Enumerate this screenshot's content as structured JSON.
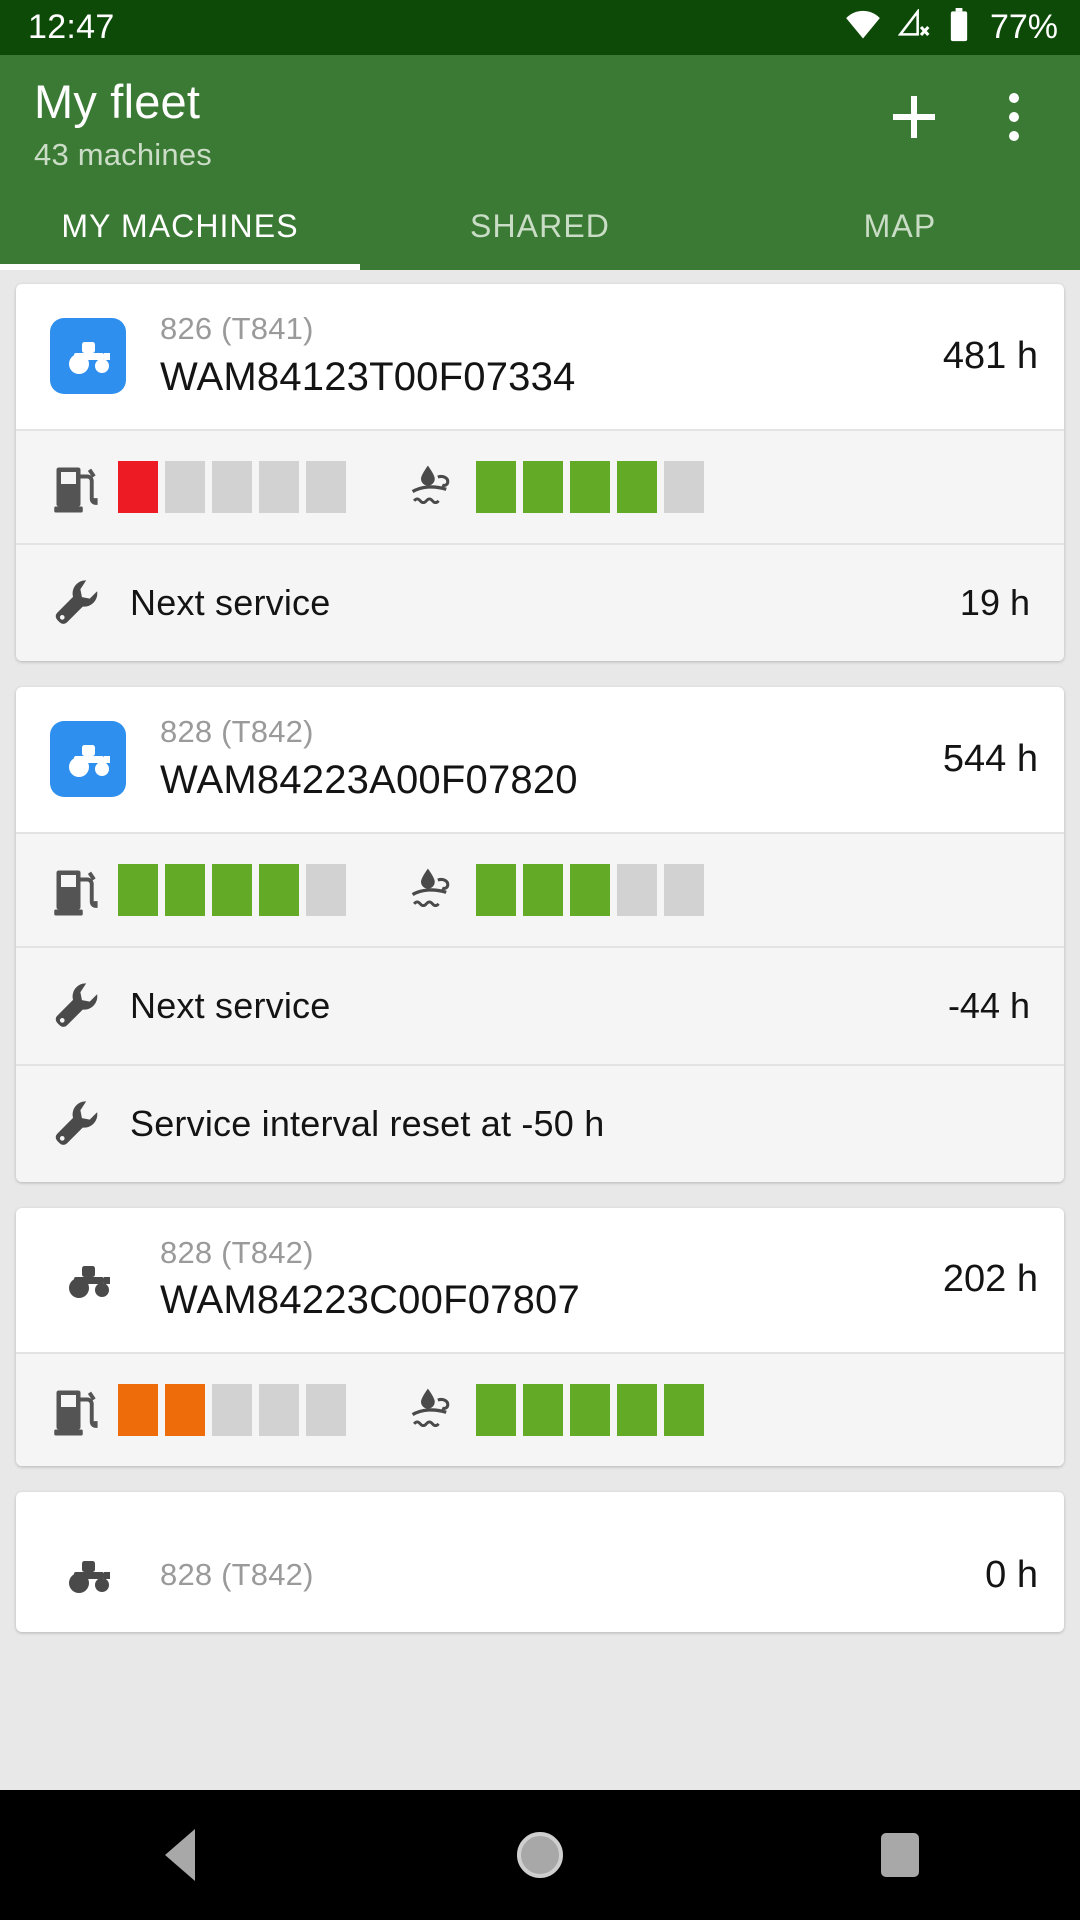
{
  "status_bar": {
    "clock": "12:47",
    "battery_percent": "77%",
    "icons": [
      "wifi-icon",
      "cellular-off-icon",
      "battery-icon"
    ]
  },
  "app_bar": {
    "title": "My fleet",
    "subtitle": "43 machines",
    "add_label": "+",
    "overflow_label": "⋮",
    "accent_color": "#3b7a34",
    "status_bar_color": "#0d4a08"
  },
  "tabs": [
    {
      "label": "MY MACHINES",
      "active": true
    },
    {
      "label": "SHARED",
      "active": false
    },
    {
      "label": "MAP",
      "active": false
    }
  ],
  "colors": {
    "green_bar": "#63ab27",
    "red_bar": "#ed1c24",
    "orange_bar": "#ef6c0a",
    "empty_bar": "#d2d2d2",
    "icon_blue": "#2e8fef"
  },
  "machines": [
    {
      "model": "826 (T841)",
      "vin": "WAM84123T00F07334",
      "hours": "481 h",
      "icon_style": "blue",
      "fuel": [
        "r",
        "e",
        "e",
        "e",
        "e"
      ],
      "def": [
        "g",
        "g",
        "g",
        "g",
        "e"
      ],
      "rows": [
        {
          "label": "Next service",
          "value": "19 h"
        }
      ]
    },
    {
      "model": "828 (T842)",
      "vin": "WAM84223A00F07820",
      "hours": "544 h",
      "icon_style": "blue",
      "fuel": [
        "g",
        "g",
        "g",
        "g",
        "e"
      ],
      "def": [
        "g",
        "g",
        "g",
        "e",
        "e"
      ],
      "rows": [
        {
          "label": "Next service",
          "value": "-44 h"
        },
        {
          "label": "Service interval reset at -50 h",
          "value": ""
        }
      ]
    },
    {
      "model": "828 (T842)",
      "vin": "WAM84223C00F07807",
      "hours": "202 h",
      "icon_style": "plain",
      "fuel": [
        "o",
        "o",
        "e",
        "e",
        "e"
      ],
      "def": [
        "g",
        "g",
        "g",
        "g",
        "g"
      ],
      "rows": []
    },
    {
      "model": "828 (T842)",
      "vin": "",
      "hours": "0 h",
      "icon_style": "plain",
      "fuel": [],
      "def": [],
      "rows": []
    }
  ],
  "nav_bar": {
    "back": "back-icon",
    "home": "home-icon",
    "recents": "recents-icon"
  }
}
